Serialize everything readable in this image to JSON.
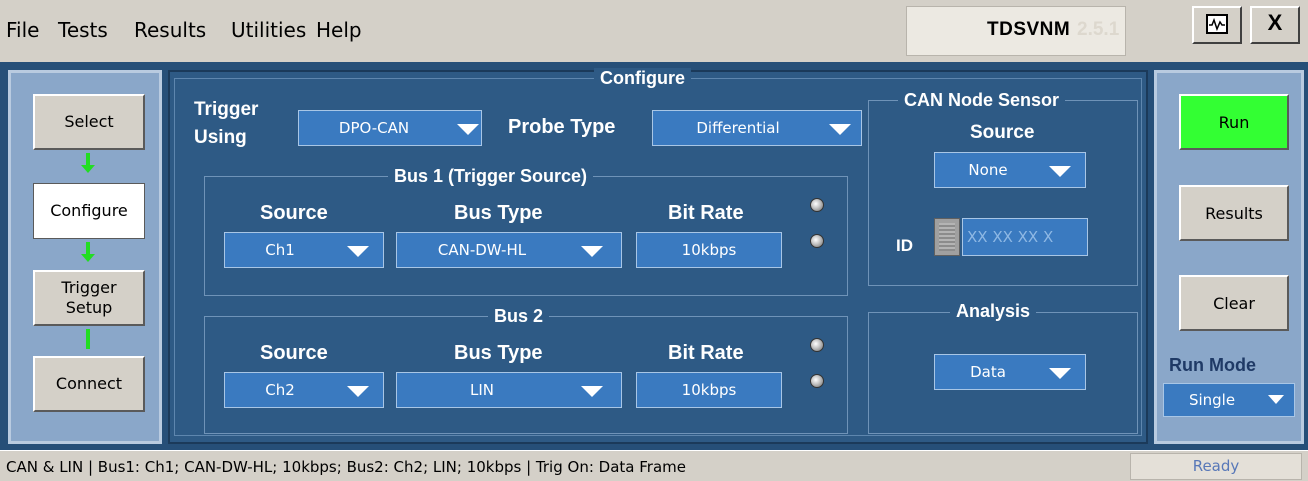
{
  "menu": {
    "file": "File",
    "tests": "Tests",
    "results": "Results",
    "utilities": "Utilities",
    "help": "Help"
  },
  "app": {
    "title": "TDSVNM",
    "version_ghost": "2.5.1",
    "close_label": "X",
    "scope_icon": "oscilloscope-icon"
  },
  "nav": {
    "select": "Select",
    "configure": "Configure",
    "trigger_setup": "Trigger\nSetup",
    "connect": "Connect",
    "active": "configure"
  },
  "configure": {
    "title": "Configure",
    "trigger_using_label": "Trigger\nUsing",
    "trigger_using_value": "DPO-CAN",
    "probe_type_label": "Probe Type",
    "probe_type_value": "Differential",
    "bus1": {
      "title": "Bus 1 (Trigger Source)",
      "source_label": "Source",
      "bus_type_label": "Bus Type",
      "bit_rate_label": "Bit Rate",
      "source_value": "Ch1",
      "bus_type_value": "CAN-DW-HL",
      "bit_rate_value": "10kbps"
    },
    "bus2": {
      "title": "Bus 2",
      "source_label": "Source",
      "bus_type_label": "Bus Type",
      "bit_rate_label": "Bit Rate",
      "source_value": "Ch2",
      "bus_type_value": "LIN",
      "bit_rate_value": "10kbps"
    },
    "can_node_sensor": {
      "title": "CAN Node Sensor",
      "source_label": "Source",
      "source_value": "None",
      "id_label": "ID",
      "id_placeholder": "XX XX XX X"
    },
    "analysis": {
      "title": "Analysis",
      "value": "Data"
    }
  },
  "right": {
    "run": "Run",
    "results": "Results",
    "clear": "Clear",
    "run_mode_label": "Run Mode",
    "run_mode_value": "Single"
  },
  "status": {
    "text": "CAN & LIN  |  Bus1: Ch1; CAN-DW-HL; 10kbps; Bus2: Ch2; LIN; 10kbps  |  Trig On: Data Frame",
    "state": "Ready"
  },
  "colors": {
    "run_button": "#33ff33",
    "panel_bg": "#2e5a85",
    "dropdown_bg": "#3a7ac0",
    "arrow": "#22dd22"
  }
}
